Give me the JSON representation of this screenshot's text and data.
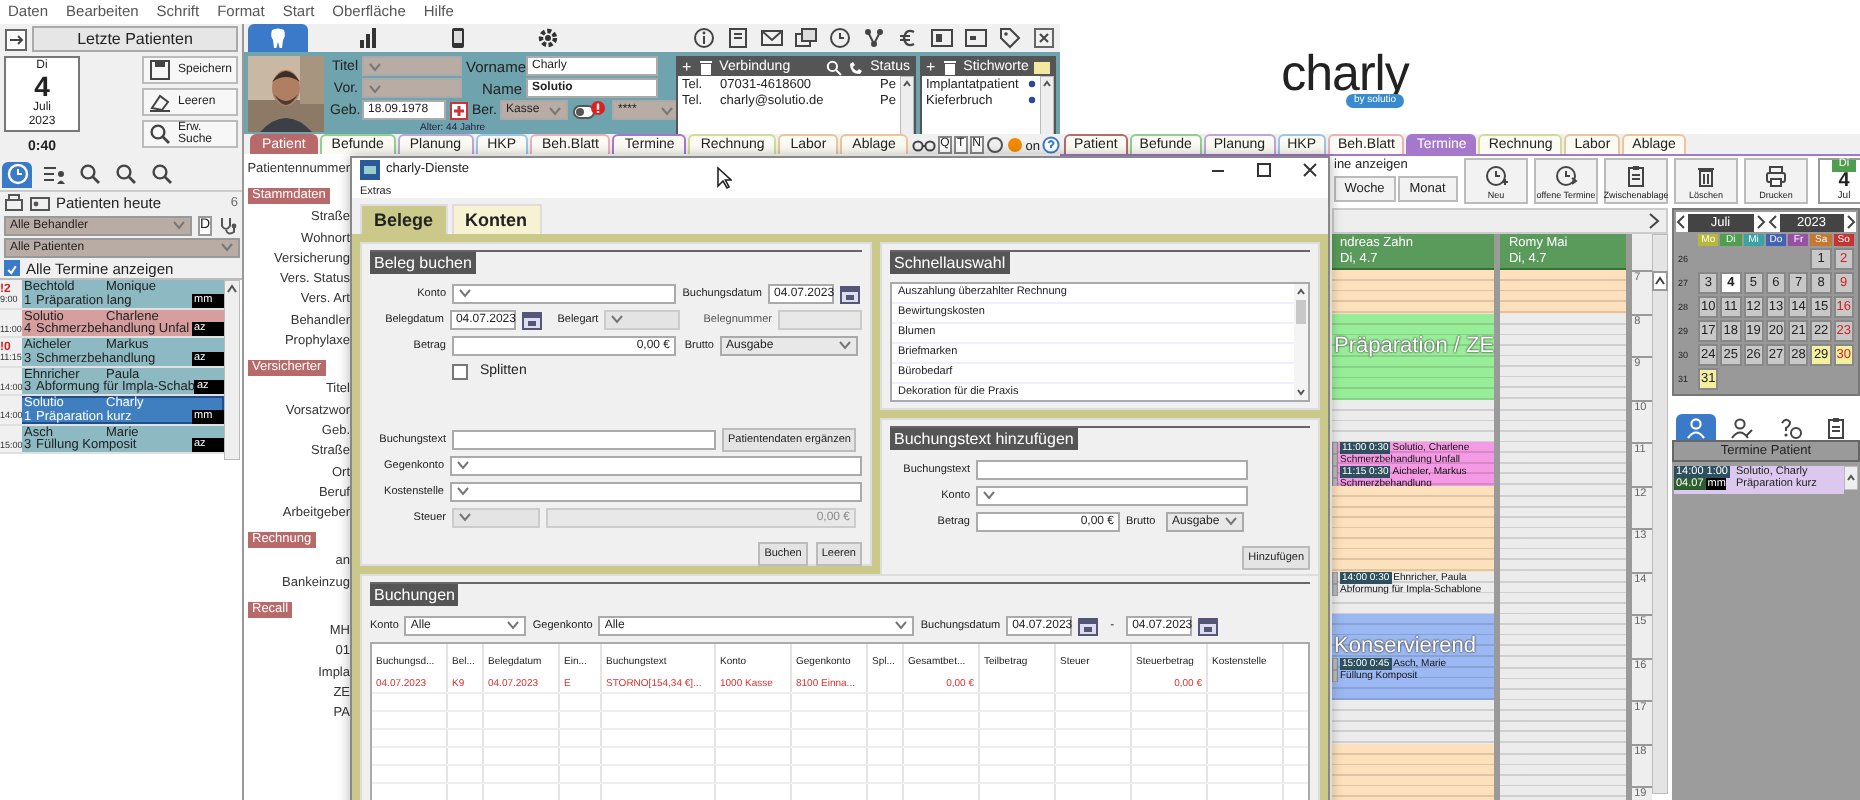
{
  "menu": [
    "Daten",
    "Bearbeiten",
    "Schrift",
    "Format",
    "Start",
    "Oberfläche",
    "Hilfe"
  ],
  "left_panel": {
    "title": "Letzte Patienten",
    "date_card": {
      "weekday": "Di",
      "day": "4",
      "month": "Juli",
      "year": "2023"
    },
    "time": "0:40",
    "buttons": [
      {
        "label": "Speichern",
        "kind": "save"
      },
      {
        "label": "Leeren",
        "kind": "clear"
      },
      {
        "label": "Erw. Suche",
        "kind": "search"
      }
    ],
    "tabs": [
      {
        "kind": "clock",
        "selected": true
      },
      {
        "kind": "list",
        "selected": false
      },
      {
        "kind": "search",
        "selected": false
      },
      {
        "kind": "search",
        "selected": false
      },
      {
        "kind": "search",
        "selected": false
      }
    ],
    "list_title": "Patienten heute",
    "count": "6",
    "filters": [
      "Alle Behandler",
      "Alle Patienten"
    ],
    "filter_button": "D",
    "show_all": {
      "label": "Alle Termine anzeigen",
      "checked": true
    },
    "appointments": [
      {
        "time": "9:00",
        "flag": "!2",
        "last": "Bechtold",
        "first": "Monique",
        "number": "1",
        "treatment": "Präparation lang",
        "tag": "mm",
        "color": "#8cb9c2",
        "selected": false
      },
      {
        "time": "11:00",
        "last": "Solutio",
        "first": "Charlene",
        "number": "4",
        "treatment": "Schmerzbehandlung Unfal",
        "tag": "az",
        "color": "#d69e9e",
        "selected": false
      },
      {
        "time": "11:15",
        "flag": "!0",
        "last": "Aicheler",
        "first": "Markus",
        "number": "3",
        "treatment": "Schmerzbehandlung",
        "tag": "az",
        "color": "#8cb9c2",
        "selected": false
      },
      {
        "time": "14:00",
        "last": "Ehnricher",
        "first": "Paula",
        "number": "3",
        "treatment": "Abformung für Impla-Schab",
        "tag": "az",
        "color": "#8cb9c2",
        "selected": false
      },
      {
        "time": "14:00",
        "last": "Solutio",
        "first": "Charly",
        "number": "1",
        "treatment": "Präparation kurz",
        "tag": "mm",
        "color": "#3f7fbf",
        "selected": true
      },
      {
        "time": "15:00",
        "last": "Asch",
        "first": "Marie",
        "number": "3",
        "treatment": "Füllung Komposit",
        "tag": "az",
        "color": "#8cb9c2",
        "selected": false
      }
    ]
  },
  "module_tabs": [
    {
      "kind": "tooth",
      "selected": true
    },
    {
      "kind": "chart",
      "selected": false
    },
    {
      "kind": "phone",
      "selected": false
    },
    {
      "kind": "gear",
      "selected": false
    }
  ],
  "patient": {
    "title_label": "Titel",
    "prefix_label": "Vor.",
    "birth_label": "Geb.",
    "birth": "18.09.1978",
    "age": "Alter: 44 Jahre",
    "first_name_label": "Vorname",
    "first_name": "Charly",
    "last_name_label": "Name",
    "last_name": "Solutio",
    "insurance_label": "Ber.",
    "insurance": "Kasse",
    "extra": "****"
  },
  "contacts": {
    "add_symbol": "+",
    "header": "Verbindung",
    "status_header": "Status",
    "rows": [
      {
        "type": "Tel.",
        "value": "07031-4618600",
        "status": "Pe"
      },
      {
        "type": "Tel.",
        "value": "charly@solutio.de",
        "status": "Pe"
      }
    ]
  },
  "keywords": {
    "add_symbol": "+",
    "header": "Stichworte",
    "items": [
      "Implantatpatient",
      "Kieferbruch"
    ]
  },
  "logo": {
    "name": "charly",
    "tagline": "by solutio"
  },
  "tabs": [
    {
      "label": "Patient",
      "color": "#b86a6a",
      "selected": true
    },
    {
      "label": "Befunde",
      "color": "#8fcf8f",
      "selected": false
    },
    {
      "label": "Planung",
      "color": "#bda6dc",
      "selected": false
    },
    {
      "label": "HKP",
      "color": "#9cc4e6",
      "selected": false
    },
    {
      "label": "Beh.Blatt",
      "color": "#eeb0b8",
      "selected": false
    },
    {
      "label": "Termine",
      "color": "#a678cc",
      "selected": false
    },
    {
      "label": "Rechnung",
      "color": "#d2dc96",
      "selected": false
    },
    {
      "label": "Labor",
      "color": "#e6c69a",
      "selected": false
    },
    {
      "label": "Ablage",
      "color": "#f0c49a",
      "selected": false
    }
  ],
  "quick_buttons": [
    "Q",
    "T",
    "N"
  ],
  "status_text": "on",
  "tabs_right": [
    {
      "label": "Patient",
      "color": "#b86a6a",
      "selected": false
    },
    {
      "label": "Befunde",
      "color": "#8fcf8f",
      "selected": false
    },
    {
      "label": "Planung",
      "color": "#bda6dc",
      "selected": false
    },
    {
      "label": "HKP",
      "color": "#9cc4e6",
      "selected": false
    },
    {
      "label": "Beh.Blatt",
      "color": "#eeb0b8",
      "selected": false
    },
    {
      "label": "Termine",
      "color": "#a678cc",
      "selected": true
    },
    {
      "label": "Rechnung",
      "color": "#d2dc96",
      "selected": false
    },
    {
      "label": "Labor",
      "color": "#e6c69a",
      "selected": false
    },
    {
      "label": "Ablage",
      "color": "#f0c49a",
      "selected": false
    }
  ],
  "record_form": [
    {
      "kind": "label",
      "text": "Patientennummer"
    },
    {
      "kind": "section",
      "text": "Stammdaten"
    },
    {
      "kind": "label",
      "text": "Straße"
    },
    {
      "kind": "label",
      "text": "Wohnort"
    },
    {
      "kind": "label",
      "text": "Versicherung"
    },
    {
      "kind": "label",
      "text": "Vers. Status"
    },
    {
      "kind": "label",
      "text": "Vers. Art"
    },
    {
      "kind": "label",
      "text": "Behandler"
    },
    {
      "kind": "label",
      "text": "Prophylaxe"
    },
    {
      "kind": "section",
      "text": "Versicherter"
    },
    {
      "kind": "label",
      "text": "Titel"
    },
    {
      "kind": "label",
      "text": "Vorsatzwor"
    },
    {
      "kind": "label",
      "text": "Geb."
    },
    {
      "kind": "label",
      "text": "Straße"
    },
    {
      "kind": "label",
      "text": "Ort"
    },
    {
      "kind": "label",
      "text": "Beruf"
    },
    {
      "kind": "label",
      "text": "Arbeitgeber"
    },
    {
      "kind": "section",
      "text": "Rechnung"
    },
    {
      "kind": "label",
      "text": "an"
    },
    {
      "kind": "label",
      "text": "Bankeinzug"
    },
    {
      "kind": "section",
      "text": "Recall"
    },
    {
      "kind": "label",
      "text": "MH"
    },
    {
      "kind": "label",
      "text": "01"
    },
    {
      "kind": "label",
      "text": "Impla"
    },
    {
      "kind": "label",
      "text": "ZE"
    },
    {
      "kind": "label",
      "text": "PA"
    }
  ],
  "dialog": {
    "title": "charly-Dienste",
    "menu": "Extras",
    "tabs": [
      {
        "label": "Belege",
        "selected": true
      },
      {
        "label": "Konten",
        "selected": false
      }
    ],
    "beleg": {
      "title": "Beleg buchen",
      "konto": "Konto",
      "buchungsdatum": {
        "label": "Buchungsdatum",
        "value": "04.07.2023"
      },
      "belegdatum": {
        "label": "Belegdatum",
        "value": "04.07.2023"
      },
      "belegart": {
        "label": "Belegart",
        "disabled": true
      },
      "belegnummer": {
        "label": "Belegnummer",
        "disabled": true
      },
      "betrag": {
        "label": "Betrag",
        "value": "0,00 €"
      },
      "brutto": {
        "label": "Brutto",
        "value": "Ausgabe"
      },
      "splitten": {
        "label": "Splitten",
        "checked": false
      },
      "buchungstext": "Buchungstext",
      "ergaenzen": "Patientendaten ergänzen",
      "gegenkonto": "Gegenkonto",
      "kostenstelle": "Kostenstelle",
      "steuer": {
        "label": "Steuer",
        "value": "0,00 €",
        "disabled": true
      },
      "buttons": [
        "Buchen",
        "Leeren"
      ]
    },
    "schnellauswahl": {
      "title": "Schnellauswahl",
      "items": [
        "Auszahlung überzahlter Rechnung",
        "Bewirtungskosten",
        "Blumen",
        "Briefmarken",
        "Bürobedarf",
        "Dekoration für die Praxis"
      ]
    },
    "hinzufuegen": {
      "title": "Buchungstext hinzufügen",
      "buchungstext": "Buchungstext",
      "konto": "Konto",
      "betrag": {
        "label": "Betrag",
        "value": "0,00 €"
      },
      "brutto": {
        "label": "Brutto",
        "value": "Ausgabe"
      },
      "button": "Hinzufügen"
    },
    "buchungen": {
      "title": "Buchungen",
      "konto": {
        "label": "Konto",
        "value": "Alle"
      },
      "gegenkonto": {
        "label": "Gegenkonto",
        "value": "Alle"
      },
      "datum": {
        "label": "Buchungsdatum",
        "from": "04.07.2023",
        "separator": "-",
        "to": "04.07.2023"
      },
      "columns": [
        "Buchungsd...",
        "Bel...",
        "Belegdatum",
        "Ein...",
        "Buchungstext",
        "Konto",
        "Gegenkonto",
        "Spl...",
        "Gesamtbet...",
        "Teilbetrag",
        "Steuer",
        "Steuerbetrag",
        "Kostenstelle"
      ],
      "rows": [
        {
          "cancelled": true,
          "cells": [
            "04.07.2023",
            "K9",
            "04.07.2023",
            "E",
            "STORNO[154,34 €]...",
            "1000 Kasse",
            "8100 Einna...",
            null,
            "0,00 €",
            null,
            null,
            "0,00 €",
            null
          ]
        }
      ]
    }
  },
  "calendar_toolbar": {
    "label": "ine anzeigen",
    "views": [
      "Woche",
      "Monat"
    ],
    "buttons": [
      {
        "label": "Neu",
        "kind": "new"
      },
      {
        "label": "offene Termine",
        "kind": "open"
      },
      {
        "label": "Zwischenablage",
        "kind": "clipboard"
      },
      {
        "label": "Löschen",
        "kind": "delete"
      },
      {
        "label": "Drucken",
        "kind": "print"
      }
    ],
    "date_card": {
      "weekday": "Di",
      "day": "4",
      "month": "Jul"
    }
  },
  "schedule": {
    "columns": [
      {
        "name": "ndreas Zahn",
        "date": "Di, 4.7",
        "slots": [
          {
            "kind": "free"
          },
          {
            "kind": "zone",
            "color": "#98ee98",
            "label": "Präparation / ZE"
          },
          {
            "kind": "zone",
            "color": "#98ee98"
          },
          {
            "kind": "open"
          },
          {
            "kind": "zone",
            "color": "#f49ae4",
            "appointments": [
              {
                "time": "11:00",
                "duration": "0:30",
                "patient": "Solutio, Charlene",
                "treatment": "Schmerzbehandlung Unfall"
              },
              {
                "time": "11:15",
                "duration": "0:30",
                "patient": "Aicheler, Markus",
                "treatment": "Schmerzbehandlung"
              }
            ]
          },
          {
            "kind": "free"
          },
          {
            "kind": "free"
          },
          {
            "kind": "open",
            "appointments": [
              {
                "time": "14:00",
                "duration": "0:30",
                "patient": "Ehnricher, Paula",
                "treatment": "Abformung für Impla-Schablone"
              }
            ]
          },
          {
            "kind": "zone",
            "color": "#9cb8f2",
            "label": "Konservierend",
            "appointments": [
              {
                "time": "15:00",
                "duration": "0:45",
                "patient": "Asch, Marie",
                "treatment": "Füllung Komposit"
              }
            ]
          },
          {
            "kind": "zone",
            "color": "#9cb8f2"
          },
          {
            "kind": "open"
          },
          {
            "kind": "free"
          },
          {
            "kind": "free"
          }
        ]
      },
      {
        "name": "Romy Mai",
        "date": "Di, 4.7",
        "slots": [
          {
            "kind": "free"
          },
          {
            "kind": "open"
          },
          {
            "kind": "open"
          },
          {
            "kind": "open"
          },
          {
            "kind": "open"
          },
          {
            "kind": "open"
          },
          {
            "kind": "open"
          },
          {
            "kind": "open"
          },
          {
            "kind": "open"
          },
          {
            "kind": "open"
          },
          {
            "kind": "open"
          },
          {
            "kind": "open"
          },
          {
            "kind": "open"
          }
        ]
      }
    ],
    "hours": [
      "7",
      "8",
      "9",
      "10",
      "11",
      "12",
      "13",
      "14",
      "15",
      "16",
      "17",
      "18",
      "19"
    ]
  },
  "mini_calendar": {
    "month": "Juli",
    "year": "2023",
    "weekdays": [
      {
        "label": "Mo",
        "color": "#b5b83a"
      },
      {
        "label": "Di",
        "color": "#4f9e4f"
      },
      {
        "label": "Mi",
        "color": "#3aa3a3"
      },
      {
        "label": "Do",
        "color": "#4462b2"
      },
      {
        "label": "Fr",
        "color": "#9552a3"
      },
      {
        "label": "Sa",
        "color": "#c47832"
      },
      {
        "label": "So",
        "color": "#c43434"
      }
    ],
    "weeks": [
      {
        "number": "26",
        "days": [
          {
            "day": "1",
            "kind": "day"
          },
          {
            "day": "2",
            "kind": "sun"
          }
        ]
      },
      {
        "number": "27",
        "days": [
          {
            "day": "3",
            "kind": "day"
          },
          {
            "day": "4",
            "kind": "today"
          },
          {
            "day": "5",
            "kind": "day"
          },
          {
            "day": "6",
            "kind": "day"
          },
          {
            "day": "7",
            "kind": "day"
          },
          {
            "day": "8",
            "kind": "day"
          },
          {
            "day": "9",
            "kind": "sun"
          }
        ]
      },
      {
        "number": "28",
        "days": [
          {
            "day": "10",
            "kind": "day"
          },
          {
            "day": "11",
            "kind": "day"
          },
          {
            "day": "12",
            "kind": "day"
          },
          {
            "day": "13",
            "kind": "day"
          },
          {
            "day": "14",
            "kind": "day"
          },
          {
            "day": "15",
            "kind": "day"
          },
          {
            "day": "16",
            "kind": "sun"
          }
        ]
      },
      {
        "number": "29",
        "days": [
          {
            "day": "17",
            "kind": "day"
          },
          {
            "day": "18",
            "kind": "day"
          },
          {
            "day": "19",
            "kind": "day"
          },
          {
            "day": "20",
            "kind": "day"
          },
          {
            "day": "21",
            "kind": "day"
          },
          {
            "day": "22",
            "kind": "day"
          },
          {
            "day": "23",
            "kind": "sun"
          }
        ]
      },
      {
        "number": "30",
        "days": [
          {
            "day": "24",
            "kind": "day"
          },
          {
            "day": "25",
            "kind": "day"
          },
          {
            "day": "26",
            "kind": "day"
          },
          {
            "day": "27",
            "kind": "day"
          },
          {
            "day": "28",
            "kind": "day"
          },
          {
            "day": "29",
            "kind": "holiday"
          },
          {
            "day": "30",
            "kind": "holiday_sun"
          }
        ]
      },
      {
        "number": "31",
        "days": [
          {
            "day": "31",
            "kind": "holiday"
          }
        ]
      }
    ]
  },
  "patient_panel": {
    "tabs": [
      {
        "kind": "person",
        "selected": true
      },
      {
        "kind": "person-edit",
        "selected": false
      },
      {
        "kind": "question",
        "selected": false
      },
      {
        "kind": "clipboard",
        "selected": false
      }
    ],
    "title": "Termine Patient",
    "entries": [
      {
        "time": "14:00",
        "duration": "1:00",
        "date": "04.07",
        "tag": "mm",
        "patient": "Solutio, Charly",
        "treatment": "Präparation kurz"
      }
    ]
  }
}
